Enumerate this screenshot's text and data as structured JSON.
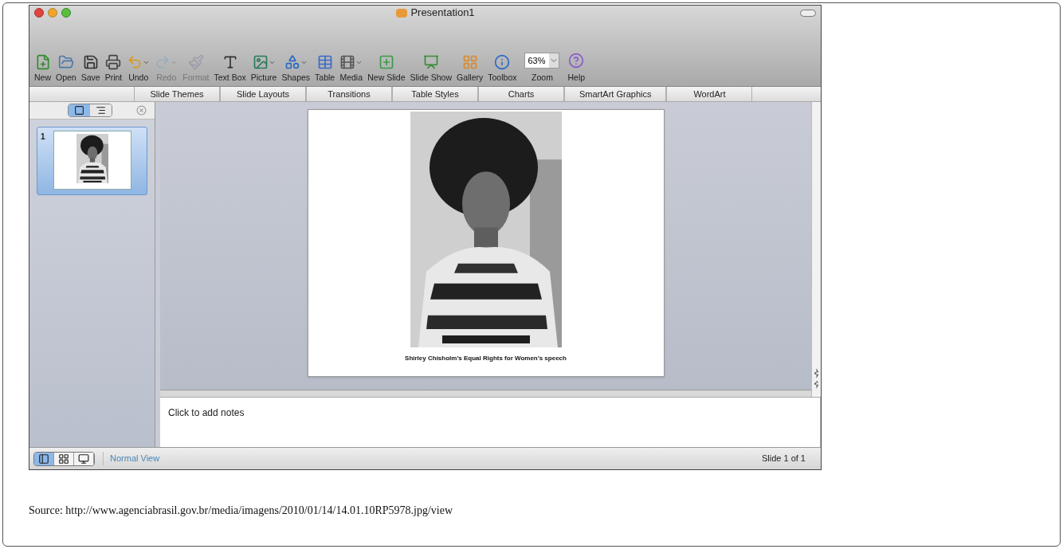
{
  "window": {
    "title": "Presentation1"
  },
  "toolbar": [
    {
      "label": "New",
      "kind": "new",
      "disabled": false,
      "dropdown": false
    },
    {
      "label": "Open",
      "kind": "open",
      "disabled": false,
      "dropdown": false
    },
    {
      "label": "Save",
      "kind": "save",
      "disabled": false,
      "dropdown": false
    },
    {
      "label": "Print",
      "kind": "print",
      "disabled": false,
      "dropdown": false
    },
    {
      "label": "Undo",
      "kind": "undo",
      "disabled": false,
      "dropdown": true
    },
    {
      "label": "Redo",
      "kind": "redo",
      "disabled": true,
      "dropdown": true
    },
    {
      "label": "Format",
      "kind": "format",
      "disabled": true,
      "dropdown": false
    },
    {
      "label": "Text Box",
      "kind": "textbox",
      "disabled": false,
      "dropdown": false
    },
    {
      "label": "Picture",
      "kind": "picture",
      "disabled": false,
      "dropdown": true
    },
    {
      "label": "Shapes",
      "kind": "shapes",
      "disabled": false,
      "dropdown": true
    },
    {
      "label": "Table",
      "kind": "table",
      "disabled": false,
      "dropdown": false
    },
    {
      "label": "Media",
      "kind": "media",
      "disabled": false,
      "dropdown": true
    },
    {
      "label": "New Slide",
      "kind": "newslide",
      "disabled": false,
      "dropdown": false
    },
    {
      "label": "Slide Show",
      "kind": "slideshow",
      "disabled": false,
      "dropdown": false
    },
    {
      "label": "Gallery",
      "kind": "gallery",
      "disabled": false,
      "dropdown": false
    },
    {
      "label": "Toolbox",
      "kind": "toolbox",
      "disabled": false,
      "dropdown": false
    }
  ],
  "zoom": {
    "value": "63%",
    "label": "Zoom"
  },
  "help": {
    "label": "Help"
  },
  "ribbon_tabs": [
    "Slide Themes",
    "Slide Layouts",
    "Transitions",
    "Table Styles",
    "Charts",
    "SmartArt Graphics",
    "WordArt"
  ],
  "slide_pane": {
    "view_toggle": [
      {
        "kind": "slides",
        "selected": true
      },
      {
        "kind": "outline",
        "selected": false
      }
    ],
    "slides": [
      {
        "number": "1",
        "selected": true,
        "kind": "picture"
      }
    ]
  },
  "slide": {
    "kind": "picture",
    "caption": "Shirley Chisholm’s Equal Rights for Women’s speech"
  },
  "notes": {
    "placeholder": "Click to add notes"
  },
  "status_bar": {
    "views": [
      {
        "kind": "normal",
        "selected": true
      },
      {
        "kind": "sorter",
        "selected": false
      },
      {
        "kind": "show",
        "selected": false
      }
    ],
    "view_name": "Normal View",
    "slide_count": "Slide 1 of 1"
  },
  "source": "Source: http://www.agenciabrasil.gov.br/media/imagens/2010/01/14/14.01.10RP5978.jpg/view"
}
